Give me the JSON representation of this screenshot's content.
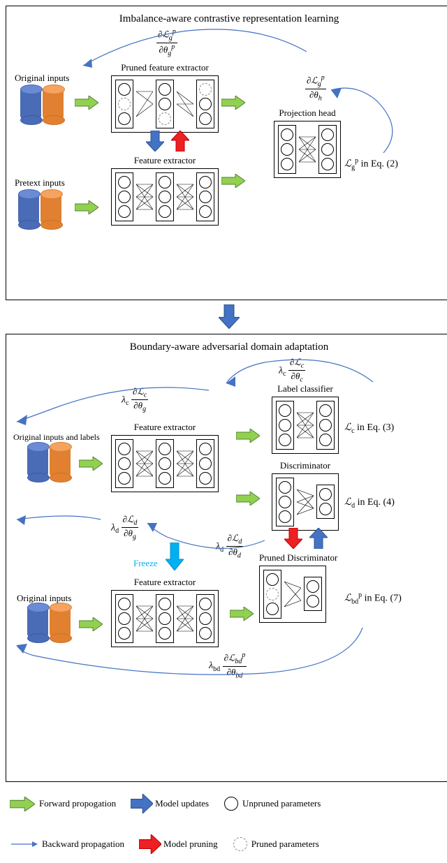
{
  "panel1": {
    "title": "Imbalance-aware contrastive representation learning",
    "inputs1": "Original inputs",
    "inputs2": "Pretext inputs",
    "box_pruned_fe": "Pruned feature extractor",
    "box_fe": "Feature extractor",
    "box_proj": "Projection head",
    "loss_g": "ℒ",
    "loss_g_sub": "g",
    "loss_g_sup": "p",
    "loss_g_eq": " in Eq. (2)",
    "grad1_n_sym": "∂ℒ",
    "grad1_n_sub": "g",
    "grad1_n_sup": "p",
    "grad1_d_sym": "∂θ",
    "grad1_d_sub": "g",
    "grad1_d_sup": "p",
    "grad2_n_sym": "∂ℒ",
    "grad2_n_sub": "g",
    "grad2_n_sup": "p",
    "grad2_d_sym": "∂θ",
    "grad2_d_sub": "h",
    "grad2_d_sup": ""
  },
  "panel2": {
    "title": "Boundary-aware adversarial domain adaptation",
    "inputs1": "Original inputs and labels",
    "inputs2": "Original inputs",
    "box_fe": "Feature extractor",
    "box_fe2": "Feature extractor",
    "box_label": "Label classifier",
    "box_disc": "Discriminator",
    "box_pdisc": "Pruned Discriminator",
    "freeze": "Freeze",
    "loss_c": "ℒ",
    "loss_c_sub": "c",
    "loss_c_eq": " in Eq. (3)",
    "loss_d": "ℒ",
    "loss_d_sub": "d",
    "loss_d_eq": " in Eq. (4)",
    "loss_bd": "ℒ",
    "loss_bd_sub": "bd",
    "loss_bd_sup": "p",
    "loss_bd_eq": " in Eq. (7)",
    "lam_c": "λ",
    "lam_c_sub": "c",
    "lam_d": "λ",
    "lam_d_sub": "d",
    "lam_bd": "λ",
    "lam_bd_sub": "bd",
    "g_c_g_n": "∂ℒ",
    "g_c_g_n_sub": "c",
    "g_c_g_d": "∂θ",
    "g_c_g_d_sub": "g",
    "g_c_c_n": "∂ℒ",
    "g_c_c_n_sub": "c",
    "g_c_c_d": "∂θ",
    "g_c_c_d_sub": "c",
    "g_d_g_n": "∂ℒ",
    "g_d_g_n_sub": "d",
    "g_d_g_d": "∂θ",
    "g_d_g_d_sub": "g",
    "g_d_d_n": "∂ℒ",
    "g_d_d_n_sub": "d",
    "g_d_d_d": "∂θ",
    "g_d_d_d_sub": "d",
    "g_bd_n": "∂ℒ",
    "g_bd_n_sub": "bd",
    "g_bd_n_sup": "p",
    "g_bd_d": "∂θ",
    "g_bd_d_sub": "bd"
  },
  "legend": {
    "forward": "Forward propogation",
    "backward": "Backward propagation",
    "updates": "Model updates",
    "pruning": "Model pruning",
    "unpruned": "Unpruned parameters",
    "pruned": "Pruned parameters"
  }
}
